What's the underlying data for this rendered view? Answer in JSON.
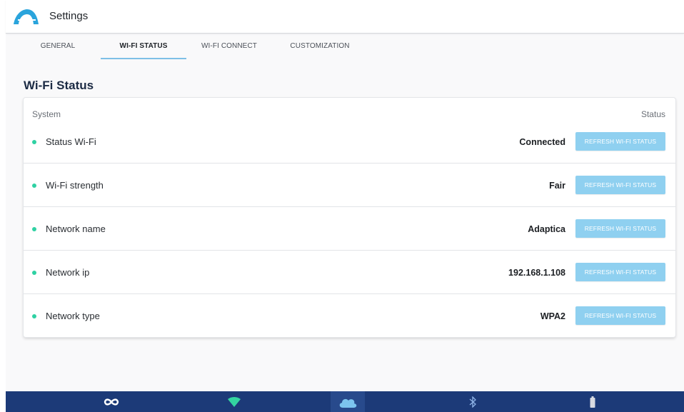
{
  "header": {
    "app_title": "Settings",
    "logo_icon": "arc-logo-icon",
    "logo_color": "#2aa4dc"
  },
  "tabs": [
    {
      "label": "GENERAL",
      "active": false
    },
    {
      "label": "WI-FI STATUS",
      "active": true
    },
    {
      "label": "WI-FI CONNECT",
      "active": false
    },
    {
      "label": "CUSTOMIZATION",
      "active": false
    }
  ],
  "section": {
    "title": "Wi-Fi Status"
  },
  "table": {
    "col_system": "System",
    "col_status": "Status",
    "rows": [
      {
        "label": "Status Wi-Fi",
        "value": "Connected",
        "button": "REFRESH WI-FI STATUS",
        "dot_color": "#2fd1a3"
      },
      {
        "label": "Wi-Fi strength",
        "value": "Fair",
        "button": "REFRESH WI-FI STATUS",
        "dot_color": "#2fd1a3"
      },
      {
        "label": "Network name",
        "value": "Adaptica",
        "button": "REFRESH WI-FI STATUS",
        "dot_color": "#2fd1a3"
      },
      {
        "label": "Network ip",
        "value": "192.168.1.108",
        "button": "REFRESH WI-FI STATUS",
        "dot_color": "#2fd1a3"
      },
      {
        "label": "Network type",
        "value": "WPA2",
        "button": "REFRESH WI-FI STATUS",
        "dot_color": "#2fd1a3"
      }
    ]
  },
  "bottom_bar": {
    "background": "#1c3a78",
    "icons": [
      "infinity-icon",
      "wifi-icon",
      "cloud-icon",
      "bluetooth-icon",
      "battery-icon"
    ],
    "wifi_color": "#33d4a0",
    "cloud_color": "#7cc4ee"
  },
  "colors": {
    "accent": "#8fd0f0",
    "tab_underline": "#7ec0e6",
    "title": "#1c2b44"
  }
}
